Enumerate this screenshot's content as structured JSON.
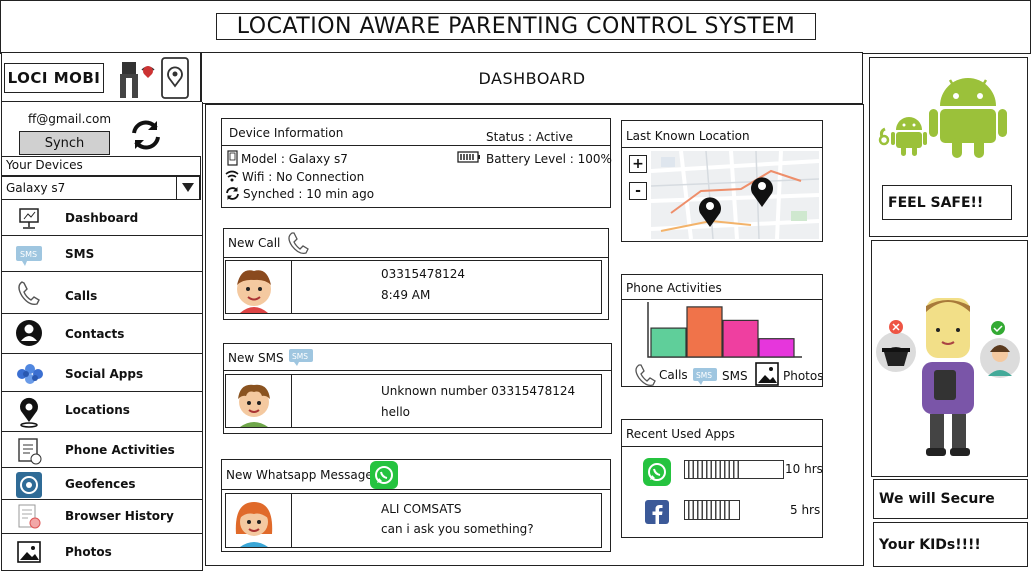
{
  "header": {
    "title": "LOCATION AWARE PARENTING CONTROL SYSTEM"
  },
  "brand": {
    "name": "LOCI MOBI"
  },
  "topbar": {
    "title": "DASHBOARD"
  },
  "account": {
    "email": "ff@gmail.com",
    "sync_label": "Synch",
    "devices_label": "Your Devices",
    "selected_device": "Galaxy s7"
  },
  "sidebar": {
    "items": [
      {
        "label": "Dashboard",
        "icon": "monitor-icon"
      },
      {
        "label": "SMS",
        "icon": "sms-icon"
      },
      {
        "label": "Calls",
        "icon": "phone-icon"
      },
      {
        "label": "Contacts",
        "icon": "contact-icon"
      },
      {
        "label": "Social Apps",
        "icon": "social-icon"
      },
      {
        "label": "Locations",
        "icon": "location-pin-icon"
      },
      {
        "label": "Phone Activities",
        "icon": "activity-icon"
      },
      {
        "label": "Geofences",
        "icon": "geofence-icon"
      },
      {
        "label": "Browser History",
        "icon": "browser-history-icon"
      },
      {
        "label": "Photos",
        "icon": "photo-icon"
      }
    ]
  },
  "device_info": {
    "header": "Device Information",
    "status": "Status : Active",
    "model": "Model : Galaxy s7",
    "battery": "Battery Level : 100%",
    "wifi": "Wifi : No Connection",
    "synched": "Synched : 10 min ago"
  },
  "new_call": {
    "header": "New Call",
    "number": "03315478124",
    "time": "8:49 AM"
  },
  "new_sms": {
    "header": "New SMS",
    "from": "Unknown number 03315478124",
    "text": "hello"
  },
  "new_whatsapp": {
    "header": "New Whatsapp Message",
    "from": "ALI COMSATS",
    "text": "can i ask you something?"
  },
  "location": {
    "header": "Last Known Location",
    "zoom_in": "+",
    "zoom_out": "-"
  },
  "phone_activities": {
    "header": "Phone Activities",
    "legend": [
      {
        "label": "Calls",
        "icon": "phone-icon"
      },
      {
        "label": "SMS",
        "icon": "sms-icon"
      },
      {
        "label": "Photos",
        "icon": "photo-icon"
      }
    ]
  },
  "chart_data": {
    "type": "bar",
    "categories": [
      "",
      "",
      "",
      ""
    ],
    "values": [
      30,
      52,
      38,
      19
    ],
    "colors": [
      "#5fcf9a",
      "#f0734a",
      "#ef3fa0",
      "#e636dc"
    ],
    "ylim": [
      0,
      55
    ]
  },
  "recent_apps": {
    "header": "Recent Used Apps",
    "apps": [
      {
        "name": "whatsapp-icon",
        "usage": "10 hrs",
        "fill": 0.55
      },
      {
        "name": "facebook-icon",
        "usage": "5 hrs",
        "fill": 0.85
      }
    ]
  },
  "promo": {
    "feel_safe": "FEEL SAFE!!",
    "line1": "We will Secure",
    "line2": "Your KIDs!!!!"
  }
}
